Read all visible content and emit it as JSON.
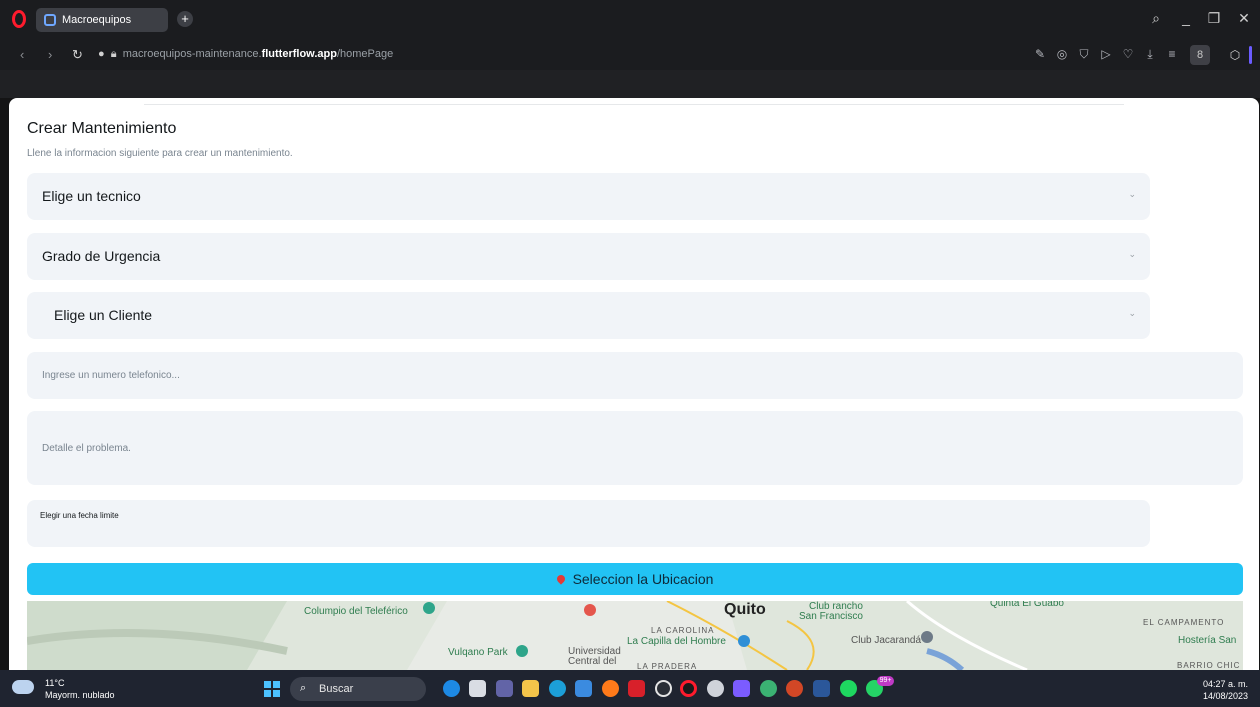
{
  "browser": {
    "tab_title": "Macroequipos",
    "url_prefix": "macroequipos-maintenance.",
    "url_domain": "flutterflow.app",
    "url_path": "/homePage",
    "profile_label": "8"
  },
  "form": {
    "title": "Crear Mantenimiento",
    "subtitle": "Llene la informacion siguiente para crear un mantenimiento.",
    "tecnico_label": "Elige un tecnico",
    "urgencia_label": "Grado de Urgencia",
    "cliente_label": "Elige un Cliente",
    "telefono_placeholder": "Ingrese un numero telefonico...",
    "problema_placeholder": "Detalle el problema.",
    "fecha_label": "Elegir una fecha limite",
    "ubicacion_button": "Seleccion la Ubicacion"
  },
  "map": {
    "labels": {
      "columpio": "Columpio del Teleférico",
      "quito": "Quito",
      "club_rancho": "Club rancho",
      "san_francisco": "San Francisco",
      "quinta": "Quinta El Guabo",
      "carolina": "LA CAROLINA",
      "capilla": "La Capilla del Hombre",
      "jacaranda": "Club Jacarandá",
      "vulqano": "Vulqano Park",
      "universidad": "Universidad",
      "central": "Central del",
      "campamento": "EL CAMPAMENTO",
      "hosteria": "Hostería San",
      "barrio": "BARRIO CHIC",
      "pradera": "LA PRADERA"
    }
  },
  "taskbar": {
    "temperature": "11°C",
    "condition": "Mayorm. nublado",
    "search_label": "Buscar",
    "badge": "99+",
    "time": "04:27 a. m.",
    "date": "14/08/2023"
  },
  "colors": {
    "accent": "#22c3f4",
    "field_bg": "#f1f4f8"
  }
}
